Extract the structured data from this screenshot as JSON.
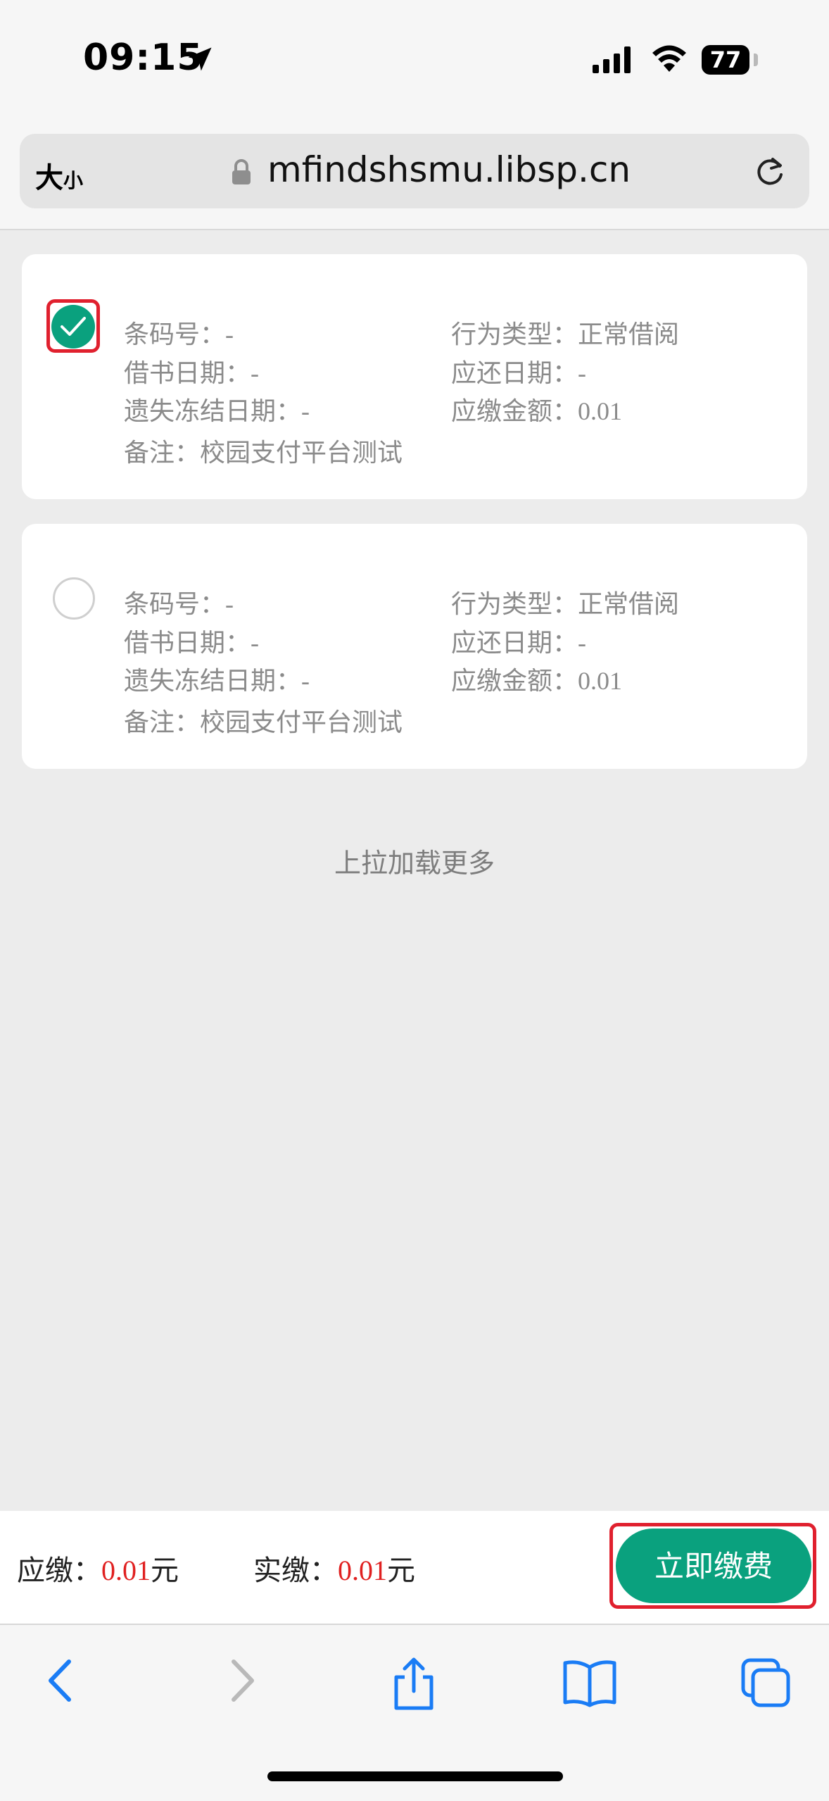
{
  "status_bar": {
    "time": "09:15",
    "battery": "77"
  },
  "browser": {
    "text_size_big": "大",
    "text_size_small": "小",
    "url": "mfindshsmu.libsp.cn"
  },
  "records": [
    {
      "selected": true,
      "barcode": "条码号：-",
      "action_type": "行为类型：正常借阅",
      "borrow_date": "借书日期：-",
      "due_date": "应还日期：-",
      "freeze_date": "遗失冻结日期：-",
      "amount": "应缴金额：0.01",
      "note": "备注：校园支付平台测试"
    },
    {
      "selected": false,
      "barcode": "条码号：-",
      "action_type": "行为类型：正常借阅",
      "borrow_date": "借书日期：-",
      "due_date": "应还日期：-",
      "freeze_date": "遗失冻结日期：-",
      "amount": "应缴金额：0.01",
      "note": "备注：校园支付平台测试"
    }
  ],
  "load_more": "上拉加载更多",
  "payment": {
    "due_label": "应缴：",
    "due_amount": "0.01",
    "due_unit": "元",
    "actual_label": "实缴：",
    "actual_amount": "0.01",
    "actual_unit": "元",
    "pay_button": "立即缴费"
  },
  "colors": {
    "accent": "#0aa17e",
    "amount_red": "#e02020",
    "highlight": "#e0202e"
  },
  "icons": [
    "location-arrow-icon",
    "signal-icon",
    "wifi-icon",
    "lock-icon",
    "reload-icon",
    "back-icon",
    "forward-icon",
    "share-icon",
    "bookmarks-icon",
    "tabs-icon"
  ]
}
